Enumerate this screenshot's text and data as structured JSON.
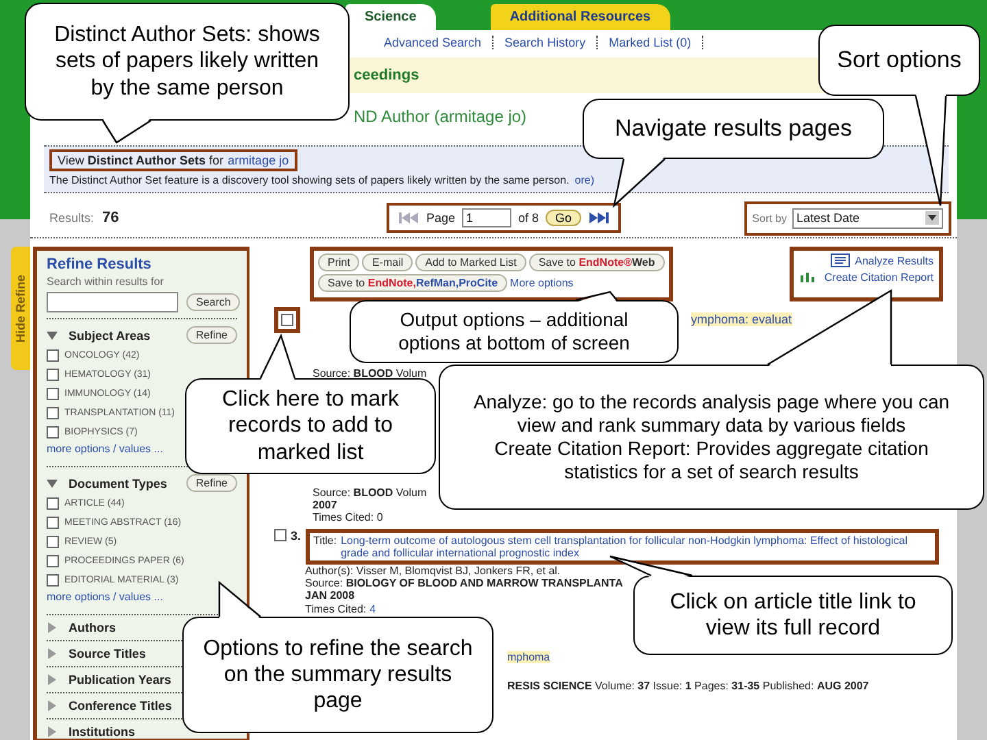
{
  "tabs": [
    {
      "label": "Science",
      "selected": true
    },
    {
      "label": "Additional Resources",
      "selected": false
    }
  ],
  "nav_links": [
    "Advanced Search",
    "Search History",
    "Marked List (0)"
  ],
  "banner": "ceedings",
  "query_title": "ND Author (armitage jo)",
  "distinct_author": {
    "text": "View **Distinct Author Sets** for",
    "link": "armitage jo",
    "description": "The Distinct Author Set feature is a discovery tool showing sets of papers likely written by the same person.",
    "more": "ore)"
  },
  "results": {
    "label": "Results:",
    "count": "76"
  },
  "pager": {
    "page_label": "Page",
    "page_value": "1",
    "of": "of 8",
    "go": "Go"
  },
  "sort": {
    "label": "Sort by",
    "value": "Latest Date"
  },
  "output_buttons": [
    "Print",
    "E-mail",
    "Add to Marked List"
  ],
  "save_web": {
    "prefix": "Save to",
    "brand": "EndNote®",
    "suffix": "Web"
  },
  "save_desktop": {
    "prefix": "Save to",
    "targets": [
      "EndNote,",
      "RefMan,",
      "ProCite"
    ]
  },
  "more_options": "More options",
  "analysis_links": [
    "Analyze Results",
    "Create Citation Report"
  ],
  "hide_refine": "Hide Refine",
  "refine": {
    "title": "Refine Results",
    "search_label": "Search within results for",
    "search_button": "Search",
    "sections": [
      {
        "title": "Subject Areas",
        "expanded": true,
        "button": "Refine",
        "items": [
          {
            "label": "ONCOLOGY (42)",
            "checked": false
          },
          {
            "label": "HEMATOLOGY (31)",
            "checked": false
          },
          {
            "label": "IMMUNOLOGY (14)",
            "checked": false
          },
          {
            "label": "TRANSPLANTATION (11)",
            "checked": false
          },
          {
            "label": "BIOPHYSICS (7)",
            "checked": false
          }
        ],
        "more": "more options / values ..."
      },
      {
        "title": "Document Types",
        "expanded": true,
        "button": "Refine",
        "items": [
          {
            "label": "ARTICLE (44)",
            "checked": false
          },
          {
            "label": "MEETING ABSTRACT (16)",
            "checked": false
          },
          {
            "label": "REVIEW (5)",
            "checked": false
          },
          {
            "label": "PROCEEDINGS PAPER (6)",
            "checked": false
          },
          {
            "label": "EDITORIAL MATERIAL (3)",
            "checked": false
          }
        ],
        "more": "more options / values ..."
      },
      {
        "title": "Authors",
        "expanded": false
      },
      {
        "title": "Source Titles",
        "expanded": false
      },
      {
        "title": "Publication Years",
        "expanded": false
      },
      {
        "title": "Conference Titles",
        "expanded": false
      },
      {
        "title": "Institutions",
        "expanded": false
      }
    ]
  },
  "records": [
    {
      "checked": false,
      "title_fragment": "ymphoma: evaluat",
      "source": "Source: **BLOOD** Volum"
    },
    {
      "source": "Source: **BLOOD** Volum",
      "date": "2007",
      "cited_label": "Times Cited:",
      "cited": "0"
    },
    {
      "checked": false,
      "number": "3.",
      "title_label": "Title:",
      "title": "Long-term outcome of autologous stem cell transplantation for follicular non-Hodgkin lymphoma: Effect of histological grade and follicular international prognostic index",
      "authors": "Author(s): Visser M, Blomqvist BJ, Jonkers FR, et al.",
      "source": "Source: **BIOLOGY OF BLOOD AND MARROW TRANSPLANTA**",
      "date": "JAN 2008",
      "cited_label": "Times Cited:",
      "cited": "4"
    },
    {
      "title_fragment": "mphoma",
      "source": "**RESIS SCIENCE** Volume: **37** Issue: **1** Pages: **31-35** Published: **AUG 2007**"
    }
  ],
  "callouts": [
    {
      "paragraphs": [
        "Distinct Author Sets: shows  sets of papers likely written by the same person"
      ]
    },
    {
      "paragraphs": [
        "Sort options"
      ]
    },
    {
      "paragraphs": [
        "Navigate results pages"
      ]
    },
    {
      "paragraphs": [
        "Output options – additional options at bottom of screen"
      ]
    },
    {
      "paragraphs": [
        "Click here to mark records to add to marked list"
      ]
    },
    {
      "paragraphs": [
        "Analyze: go to the records analysis page where you can view and rank summary data by various fields",
        "Create Citation Report: Provides aggregate citation statistics for a set of search results"
      ]
    },
    {
      "paragraphs": [
        "Click on article title link to view its full record"
      ]
    },
    {
      "paragraphs": [
        "Options to refine the search on the summary results page"
      ]
    }
  ]
}
